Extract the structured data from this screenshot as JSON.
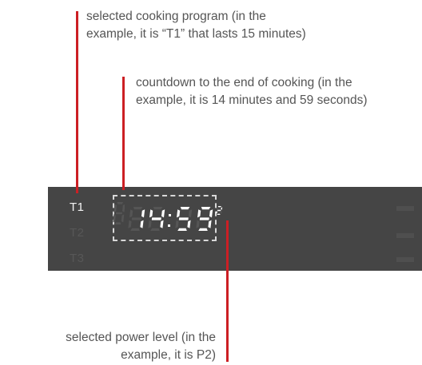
{
  "callouts": {
    "program": {
      "line1": "selected cooking program (in the",
      "line2": "example, it is “T1” that lasts 15 minutes)"
    },
    "countdown": {
      "line1": "countdown to the end of cooking  (in the",
      "line2": "example, it is 14 minutes and 59 seconds)"
    },
    "power": {
      "line1": "selected power level (in the",
      "line2": "example, it is P2)"
    }
  },
  "display": {
    "programs": [
      "T1",
      "T2",
      "T3"
    ],
    "selected_program": "T1",
    "time_digits": "1459",
    "power_level": "2"
  },
  "colors": {
    "leader": "#cc1f24",
    "panel": "#454545",
    "active_text": "#f2f2f2",
    "inactive_text": "#575757",
    "segment_on": "#ffffff",
    "segment_off": "#555555"
  }
}
